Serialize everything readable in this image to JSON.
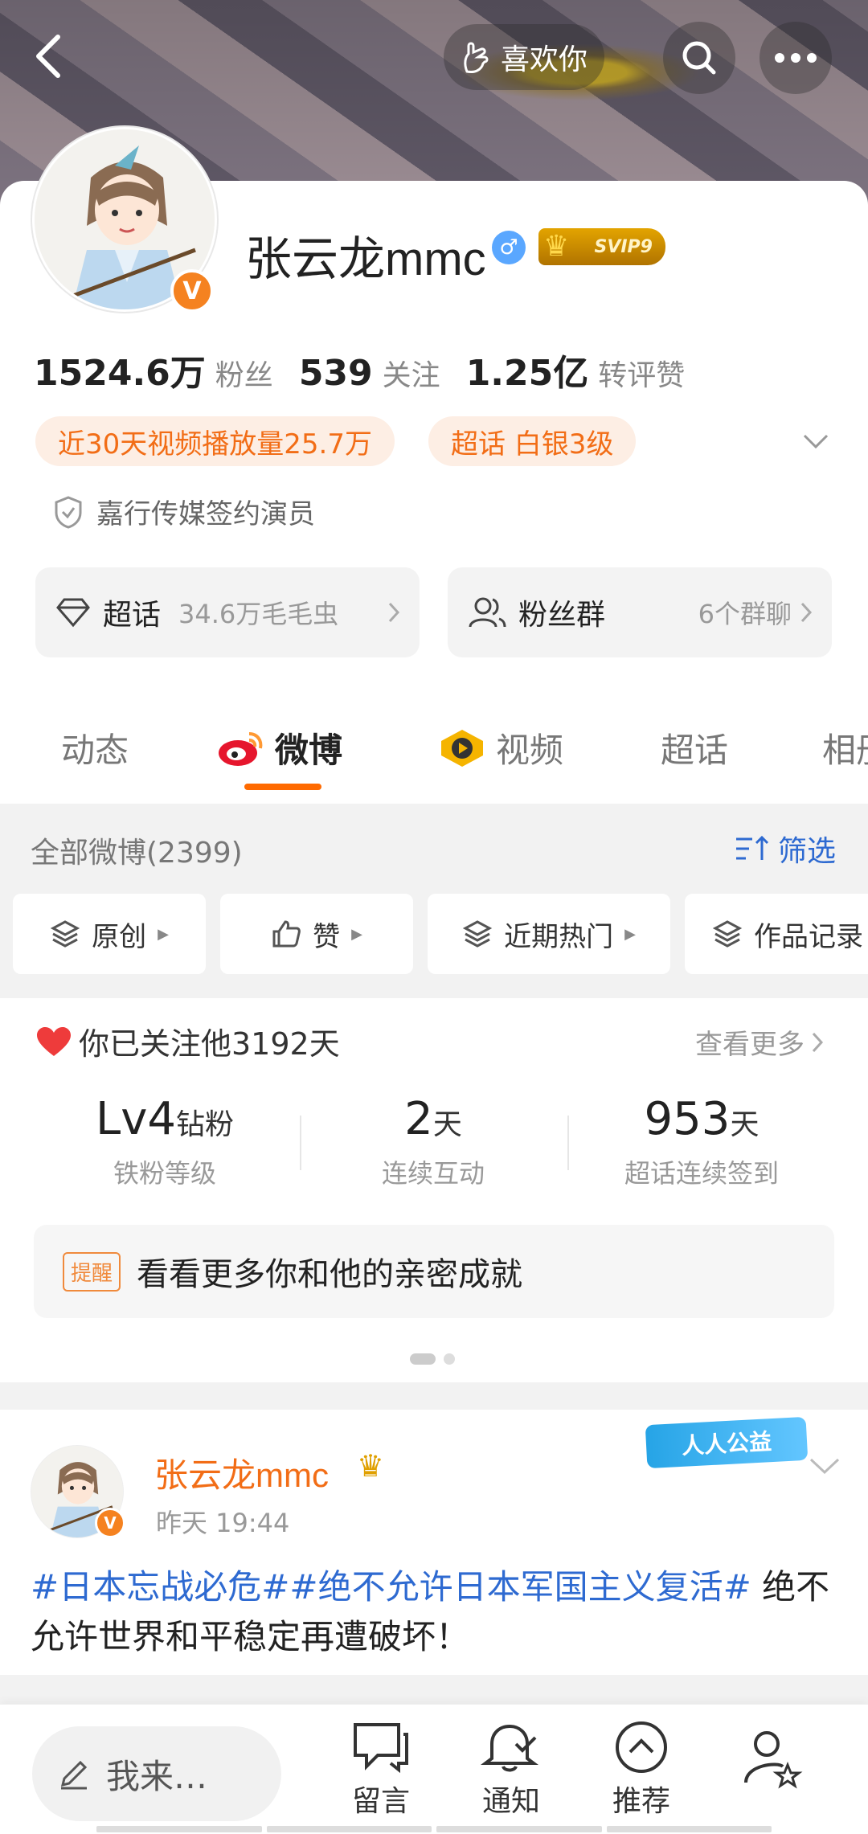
{
  "topbar": {
    "like_label": "喜欢你"
  },
  "profile": {
    "name": "张云龙mmc",
    "gender_symbol": "♂",
    "svip_label": "SVIP9",
    "verified_mark": "V",
    "stats": [
      {
        "value": "1524.6万",
        "label": "粉丝"
      },
      {
        "value": "539",
        "label": "关注"
      },
      {
        "value": "1.25亿",
        "label": "转评赞"
      }
    ],
    "pills": [
      "近30天视频播放量25.7万",
      "超话 白银3级"
    ],
    "signature": "嘉行传媒签约演员",
    "supertopic_box": {
      "title": "超话",
      "sub": "34.6万毛毛虫"
    },
    "fans_box": {
      "title": "粉丝群",
      "sub": "6个群聊"
    }
  },
  "tabs": [
    {
      "label": "动态",
      "active": false
    },
    {
      "label": "微博",
      "active": true
    },
    {
      "label": "视频",
      "active": false
    },
    {
      "label": "超话",
      "active": false
    },
    {
      "label": "相册",
      "active": false
    }
  ],
  "feed": {
    "title": "全部微博(2399)",
    "filter_label": "筛选",
    "chips": [
      "原创",
      "赞",
      "近期热门",
      "作品记录"
    ]
  },
  "follow": {
    "title": "你已关注他3192天",
    "more": "查看更多",
    "metrics": [
      {
        "value": "Lv4",
        "unit": "钻粉",
        "label": "铁粉等级"
      },
      {
        "value": "2",
        "unit": "天",
        "label": "连续互动"
      },
      {
        "value": "953",
        "unit": "天",
        "label": "超话连续签到"
      }
    ],
    "remind_tag": "提醒",
    "remind_text": "看看更多你和他的亲密成就"
  },
  "post": {
    "name": "张云龙mmc",
    "time": "昨天 19:44",
    "badge": "人人公益",
    "topic1": "#日本忘战必危#",
    "topic2": "#绝不允许日本军国主义复活#",
    "body": " 绝不允许世界和平稳定再遭破坏！"
  },
  "bottombar": {
    "compose_placeholder": "我来…",
    "items": [
      "留言",
      "通知",
      "推荐"
    ]
  },
  "colors": {
    "accent_orange": "#f26d16",
    "link_blue": "#2e6ad1",
    "verified_orange": "#f58220"
  }
}
